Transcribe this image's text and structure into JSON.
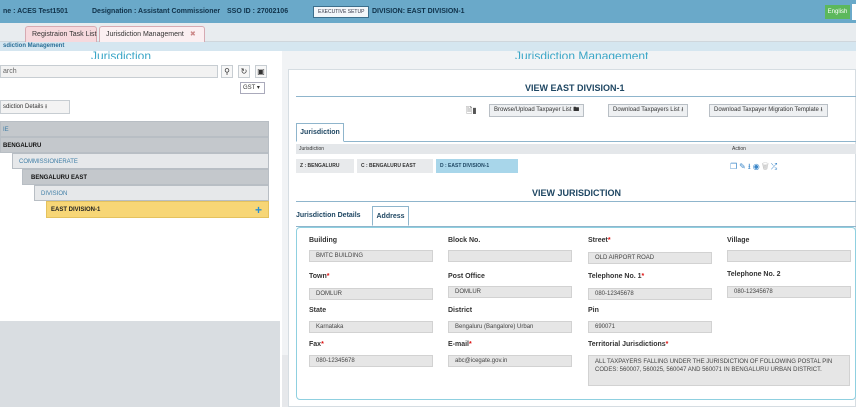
{
  "header": {
    "name_label": "ne : ACES Test1501",
    "designation": "Designation : Assistant Commissioner",
    "sso": "SSO ID : 27002106",
    "exec_button": "EXECUTIVE SETUP",
    "division": "DIVISION:  EAST DIVISION-1",
    "language": "English"
  },
  "tabs": [
    {
      "label": "Registraion Task List"
    },
    {
      "label": "Jurisdiction Management",
      "close": "✖"
    }
  ],
  "strip_text": "sdiction Management",
  "left": {
    "heading": "Jurisdiction",
    "search_placeholder": "arch",
    "gst_select": "GST",
    "jd_button": "sdiction Details",
    "tree": [
      {
        "label": "IE"
      },
      {
        "label": "BENGALURU"
      },
      {
        "label": "COMMISSIONERATE"
      },
      {
        "label": "BENGALURU EAST"
      },
      {
        "label": "DIVISION"
      },
      {
        "label": "EAST DIVISION-1"
      }
    ],
    "add_icon": "+"
  },
  "right": {
    "heading": "Jurisdiction Management",
    "view_title": "VIEW EAST DIVISION-1",
    "buttons": {
      "browse": "Browse/Upload Taxpayer List",
      "download_list": "Download Taxpayers List",
      "download_migration": "Download Taxpayer Migration Template"
    },
    "jurisdiction_tab": "Jurisdiction",
    "table_headers": {
      "jurisdiction": "Jurisdiction",
      "action": "Action"
    },
    "breadcrumb": [
      "Z : BENGALURU",
      "C : BENGALURU EAST",
      "D : EAST DIVISION-1"
    ],
    "view_jurisdiction": "VIEW JURISDICTION",
    "detail_tabs": {
      "details": "Jurisdiction Details",
      "address": "Address"
    },
    "address": {
      "building_label": "Building",
      "building": "BMTC BUILDING",
      "block_label": "Block No.",
      "block": "",
      "street_label": "Street",
      "street": "OLD AIRPORT ROAD",
      "village_label": "Village",
      "village": "",
      "town_label": "Town",
      "town": "DOMLUR",
      "post_office_label": "Post Office",
      "post_office": "DOMLUR",
      "tel1_label": "Telephone No. 1",
      "tel1": "080-12345678",
      "tel2_label": "Telephone No. 2",
      "tel2": "080-12345678",
      "state_label": "State",
      "state": "Karnataka",
      "district_label": "District",
      "district": "Bengaluru (Bangalore) Urban",
      "pin_label": "Pin",
      "pin": "690071",
      "fax_label": "Fax",
      "fax": "080-12345678",
      "email_label": "E-mail",
      "email": "abc@icegate.gov.in",
      "territorial_label": "Territorial Jurisdictions",
      "territorial": "ALL TAXPAYERS FALLING UNDER THE JURISDICTION OF FOLLOWING POSTAL PIN CODES: 560007, 560025, 560047 AND 560071 IN BENGALURU URBAN DISTRICT."
    }
  },
  "colors": {
    "accent": "#3aa6c7",
    "topbar": "#6aa9c9",
    "selected": "#f7d676",
    "required": "#dd1111"
  }
}
